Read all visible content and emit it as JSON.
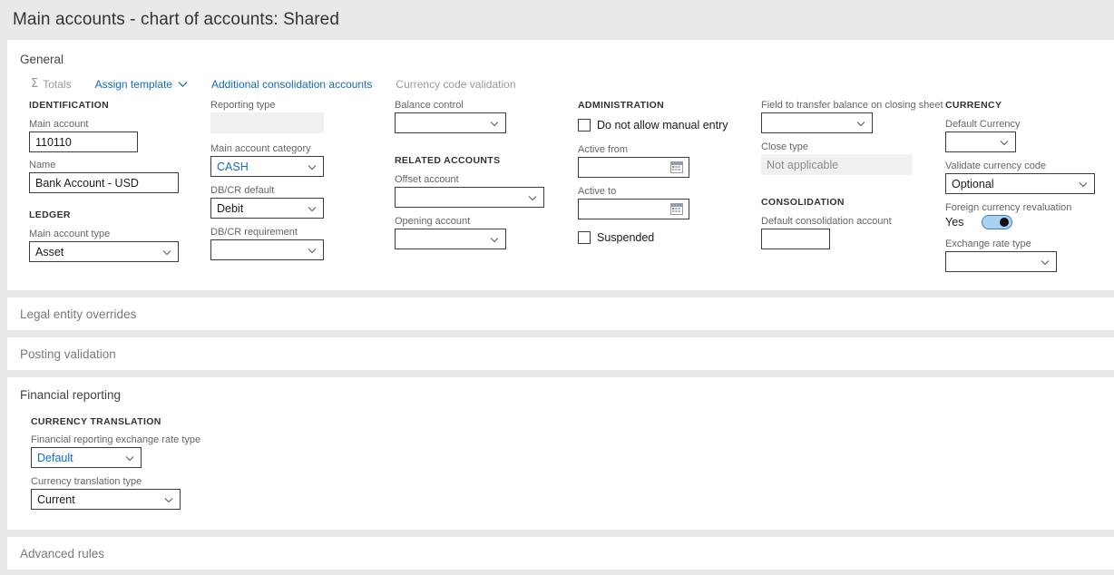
{
  "header": {
    "title": "Main accounts - chart of accounts: Shared"
  },
  "general": {
    "title": "General",
    "toolbar": [
      {
        "label": "Totals",
        "icon": "sigma-icon",
        "state": "disabled",
        "has_chevron": false
      },
      {
        "label": "Assign template",
        "icon": "",
        "state": "enabled",
        "has_chevron": true
      },
      {
        "label": "Additional consolidation accounts",
        "icon": "",
        "state": "enabled",
        "has_chevron": false
      },
      {
        "label": "Currency code validation",
        "icon": "",
        "state": "disabled",
        "has_chevron": false
      }
    ],
    "columns": {
      "identification": {
        "group1": "IDENTIFICATION",
        "main_account_label": "Main account",
        "main_account_value": "110110",
        "name_label": "Name",
        "name_value": "Bank Account - USD",
        "group2": "LEDGER",
        "main_account_type_label": "Main account type",
        "main_account_type_value": "Asset"
      },
      "reporting": {
        "reporting_type_label": "Reporting type",
        "reporting_type_value": "",
        "category_label": "Main account category",
        "category_value": "CASH",
        "dbcr_default_label": "DB/CR default",
        "dbcr_default_value": "Debit",
        "dbcr_requirement_label": "DB/CR requirement",
        "dbcr_requirement_value": ""
      },
      "related": {
        "balance_control_label": "Balance control",
        "balance_control_value": "",
        "group": "RELATED ACCOUNTS",
        "offset_account_label": "Offset account",
        "offset_account_value": "",
        "opening_account_label": "Opening account",
        "opening_account_value": ""
      },
      "administration": {
        "group": "ADMINISTRATION",
        "no_manual_entry_label": "Do not allow manual entry",
        "no_manual_entry_checked": false,
        "active_from_label": "Active from",
        "active_from_value": "",
        "active_to_label": "Active to",
        "active_to_value": "",
        "suspended_label": "Suspended",
        "suspended_checked": false
      },
      "closing": {
        "transfer_field_label": "Field to transfer balance on closing sheet",
        "transfer_field_value": "",
        "close_type_label": "Close type",
        "close_type_value": "Not applicable",
        "group": "CONSOLIDATION",
        "default_consolidation_label": "Default consolidation account",
        "default_consolidation_value": ""
      },
      "currency": {
        "group": "CURRENCY",
        "default_currency_label": "Default Currency",
        "default_currency_value": "",
        "validate_code_label": "Validate currency code",
        "validate_code_value": "Optional",
        "revaluation_label": "Foreign currency revaluation",
        "revaluation_state": "Yes",
        "exchange_rate_type_label": "Exchange rate type",
        "exchange_rate_type_value": ""
      }
    }
  },
  "legal_entity_overrides": {
    "title": "Legal entity overrides"
  },
  "posting_validation": {
    "title": "Posting validation"
  },
  "financial_reporting": {
    "title": "Financial reporting",
    "group": "CURRENCY TRANSLATION",
    "exchange_rate_type_label": "Financial reporting exchange rate type",
    "exchange_rate_type_value": "Default",
    "translation_type_label": "Currency translation type",
    "translation_type_value": "Current"
  },
  "advanced_rules": {
    "title": "Advanced rules"
  },
  "colors": {
    "accent": "#0f6cbd",
    "page_bg": "#e9e9e9",
    "panel_bg": "#ffffff",
    "label": "#666666",
    "border": "#3b3b3b",
    "toggle_track": "#a9d2f0",
    "toggle_knob": "#111111"
  }
}
